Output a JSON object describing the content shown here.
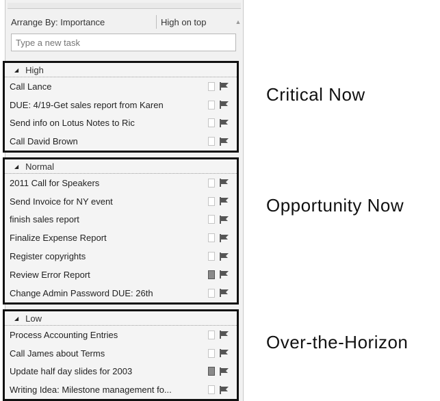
{
  "arrange": {
    "by": "Arrange By: Importance",
    "order": "High on top"
  },
  "new_task_placeholder": "Type a new task",
  "groups": [
    {
      "name": "High",
      "tasks": [
        {
          "subject": "Call Lance",
          "checked": false
        },
        {
          "subject": "DUE: 4/19-Get sales report from Karen",
          "checked": false
        },
        {
          "subject": "Send info on Lotus Notes to Ric",
          "checked": false
        },
        {
          "subject": "Call David Brown",
          "checked": false
        }
      ]
    },
    {
      "name": "Normal",
      "tasks": [
        {
          "subject": "2011 Call for Speakers",
          "checked": false
        },
        {
          "subject": "Send Invoice for NY event",
          "checked": false
        },
        {
          "subject": "finish sales report",
          "checked": false
        },
        {
          "subject": "Finalize Expense Report",
          "checked": false
        },
        {
          "subject": "Register copyrights",
          "checked": false
        },
        {
          "subject": "Review Error Report",
          "checked": true
        },
        {
          "subject": "Change Admin Password DUE: 26th",
          "checked": false
        }
      ]
    },
    {
      "name": "Low",
      "tasks": [
        {
          "subject": "Process Accounting Entries",
          "checked": false
        },
        {
          "subject": "Call James about Terms",
          "checked": false
        },
        {
          "subject": "Update half day slides for 2003",
          "checked": true
        },
        {
          "subject": "Writing Idea: Milestone management fo...",
          "checked": false
        }
      ]
    }
  ],
  "labels": [
    "Critical Now",
    "Opportunity Now",
    "Over-the-Horizon"
  ]
}
